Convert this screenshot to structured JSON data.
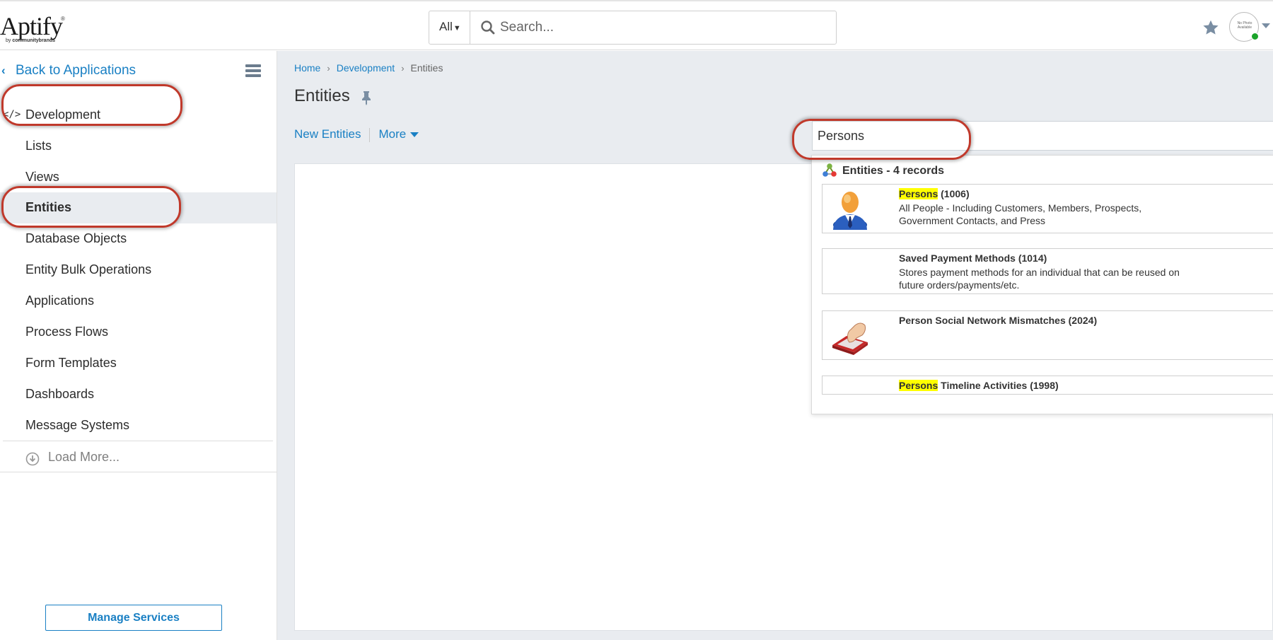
{
  "header": {
    "logo": {
      "wordmark": "Aptify",
      "registered": "®",
      "tagline_prefix": "by ",
      "tagline_brand": "communitybrands"
    },
    "search": {
      "scope": "All",
      "placeholder": "Search..."
    },
    "avatar": {
      "text": "No Photo Available",
      "status_color": "#1aa32a"
    }
  },
  "sidebar": {
    "back_label": "Back to Applications",
    "items": [
      {
        "label": "Development",
        "icon": "code-icon",
        "active": false
      },
      {
        "label": "Lists",
        "active": false
      },
      {
        "label": "Views",
        "active": false
      },
      {
        "label": "Entities",
        "active": true
      },
      {
        "label": "Database Objects",
        "active": false
      },
      {
        "label": "Entity Bulk Operations",
        "active": false
      },
      {
        "label": "Applications",
        "active": false
      },
      {
        "label": "Process Flows",
        "active": false
      },
      {
        "label": "Form Templates",
        "active": false
      },
      {
        "label": "Dashboards",
        "active": false
      },
      {
        "label": "Message Systems",
        "active": false
      }
    ],
    "load_more": "Load More...",
    "manage_services": "Manage Services"
  },
  "main": {
    "breadcrumb": [
      "Home",
      "Development",
      "Entities"
    ],
    "title": "Entities",
    "toolbar": {
      "new_label": "New Entities",
      "more_label": "More"
    },
    "entity_search": {
      "value": "Persons"
    },
    "results": {
      "header": "Entities - 4 records",
      "items": [
        {
          "highlight": "Persons",
          "title_rest": " (1006)",
          "desc": "All People - Including Customers, Members, Prospects, Government Contacts, and Press",
          "thumb": "person-icon"
        },
        {
          "highlight": "",
          "title_rest": "Saved Payment Methods (1014)",
          "desc": "Stores payment methods for an individual that can be reused on future orders/payments/etc.",
          "thumb": ""
        },
        {
          "highlight": "",
          "title_rest": "Person Social Network Mismatches (2024)",
          "desc": "",
          "thumb": "hand-tablet-icon"
        },
        {
          "highlight": "Persons",
          "title_rest": " Timeline Activities (1998)",
          "desc": "",
          "thumb": ""
        }
      ]
    }
  },
  "colors": {
    "accent": "#1a80c4",
    "annotation": "#c0392b",
    "highlight": "#ffff00",
    "content_bg": "#e9ecf0"
  }
}
